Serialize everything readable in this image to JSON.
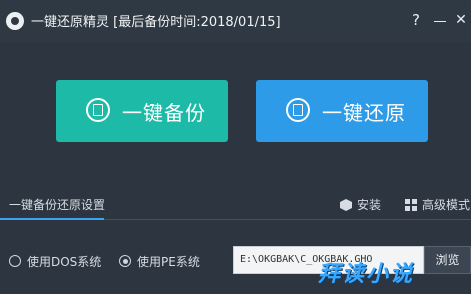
{
  "window": {
    "title": "一键还原精灵 [最后备份时间:2018/01/15]",
    "help_label": "?",
    "close_label": "✕"
  },
  "actions": {
    "backup_label": "一键备份",
    "restore_label": "一键还原"
  },
  "settings": {
    "section_title": "一键备份还原设置",
    "install_label": "安装",
    "advanced_label": "高级模式"
  },
  "mode": {
    "options": [
      "使用DOS系统",
      "使用PE系统"
    ],
    "selected": "使用PE系统"
  },
  "path": {
    "value": "E:\\OKGBAK\\C_OKGBAK.GHO",
    "browse_label": "浏览"
  },
  "watermark": {
    "text": "拜读小说"
  },
  "colors": {
    "background": "#2c3540",
    "backup_button": "#1dbba7",
    "restore_button": "#2d9be7",
    "accent": "#3aa4ee"
  }
}
